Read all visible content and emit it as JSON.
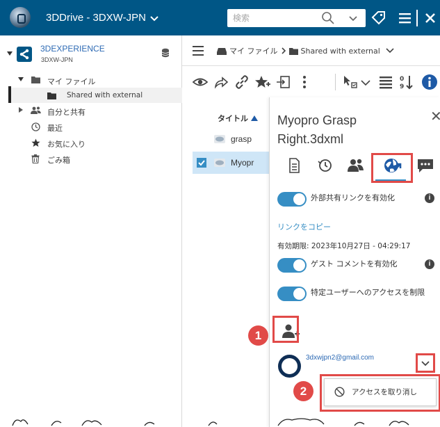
{
  "topbar": {
    "app_title": "3DDrive - 3DXW-JPN",
    "search_placeholder": "検索",
    "colors": {
      "bar": "#005686"
    }
  },
  "sidebar": {
    "platform_title": "3DEXPERIENCE",
    "platform_subtitle": "3DXW-JPN",
    "tree": [
      {
        "label": "マイ ファイル",
        "icon": "folder-icon"
      },
      {
        "label": "Shared with external",
        "icon": "folder-icon",
        "selected": true
      },
      {
        "label": "自分と共有",
        "icon": "users-icon"
      },
      {
        "label": "最近",
        "icon": "clock-icon"
      },
      {
        "label": "お気に入り",
        "icon": "star-icon"
      },
      {
        "label": "ごみ箱",
        "icon": "trash-icon"
      }
    ]
  },
  "breadcrumb": {
    "root": "マイ ファイル",
    "current": "Shared with external"
  },
  "list": {
    "column_title": "タイトル",
    "files": [
      {
        "name": "grasp",
        "checked": false
      },
      {
        "name": "Myopr",
        "checked": true
      }
    ]
  },
  "panel": {
    "title": "Myopro Grasp Right.3dxml",
    "toggle_external_link": "外部共有リンクを有効化",
    "copy_link": "リンクをコピー",
    "expiry": "有効期限: 2023年10月27日 - 04:29:17",
    "toggle_guest_comment": "ゲスト コメントを有効化",
    "toggle_restrict": "特定ユーザーへのアクセスを制限",
    "user_email": "3dxwjpn2@gmail.com",
    "revoke_label": "アクセスを取り消し",
    "badge_1": "1",
    "badge_2": "2",
    "accent": "#368ec4",
    "highlight": "#e14a48"
  }
}
